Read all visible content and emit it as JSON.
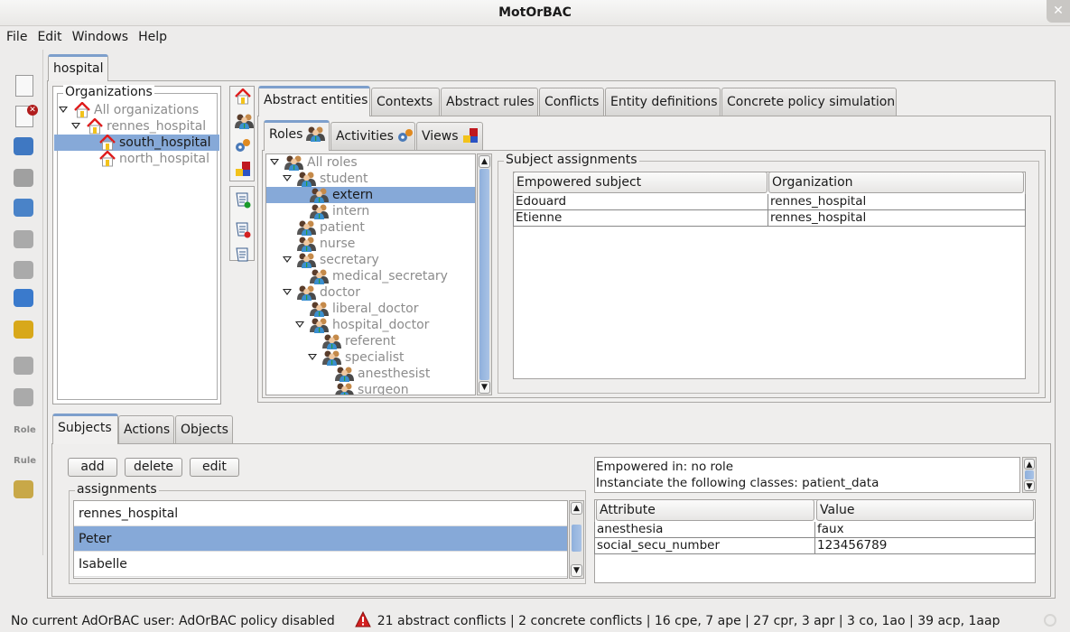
{
  "window": {
    "title": "MotOrBAC",
    "close_icon": "close-icon"
  },
  "menu": [
    "File",
    "Edit",
    "Windows",
    "Help"
  ],
  "toolbar": [
    "new-policy-icon",
    "close-policy-icon",
    "open-folder-icon",
    "save-icon",
    "save-as-icon",
    "undo-icon",
    "redo-icon",
    "refresh-icon",
    "security-lock-icon",
    "users-icon",
    "user-group-icon",
    "role-icon",
    "rule-icon",
    "search-icon"
  ],
  "toolbar_labels": {
    "role": "Role",
    "rule": "Rule"
  },
  "policy_tab": "hospital",
  "organizations": {
    "label": "Organizations",
    "items": [
      {
        "label": "All organizations",
        "depth": 0,
        "expanded": true,
        "selected": false
      },
      {
        "label": "rennes_hospital",
        "depth": 1,
        "expanded": true,
        "selected": false
      },
      {
        "label": "south_hospital",
        "depth": 2,
        "expanded": null,
        "selected": true
      },
      {
        "label": "north_hospital",
        "depth": 2,
        "expanded": null,
        "selected": false
      }
    ]
  },
  "side_icons": [
    "organization-icon",
    "roles-icon",
    "activities-icon",
    "views-icon",
    "rule-scroll-permission-icon",
    "rule-scroll-prohibition-icon",
    "rule-scroll-icon"
  ],
  "main_tabs": [
    "Abstract entities",
    "Contexts",
    "Abstract rules",
    "Conflicts",
    "Entity definitions",
    "Concrete policy simulation"
  ],
  "active_main_tab": "Abstract entities",
  "sub_tabs": [
    {
      "label": "Roles",
      "icon": "roles-icon"
    },
    {
      "label": "Activities",
      "icon": "activities-icon"
    },
    {
      "label": "Views",
      "icon": "views-icon"
    }
  ],
  "roles": [
    {
      "label": "All roles",
      "depth": 0,
      "expanded": true
    },
    {
      "label": "student",
      "depth": 1,
      "expanded": true
    },
    {
      "label": "extern",
      "depth": 2,
      "selected": true
    },
    {
      "label": "intern",
      "depth": 2
    },
    {
      "label": "patient",
      "depth": 1
    },
    {
      "label": "nurse",
      "depth": 1
    },
    {
      "label": "secretary",
      "depth": 1,
      "expanded": true
    },
    {
      "label": "medical_secretary",
      "depth": 2
    },
    {
      "label": "doctor",
      "depth": 1,
      "expanded": true
    },
    {
      "label": "liberal_doctor",
      "depth": 2
    },
    {
      "label": "hospital_doctor",
      "depth": 2,
      "expanded": true
    },
    {
      "label": "referent",
      "depth": 3
    },
    {
      "label": "specialist",
      "depth": 3,
      "expanded": true
    },
    {
      "label": "anesthesist",
      "depth": 4
    },
    {
      "label": "surgeon",
      "depth": 4
    }
  ],
  "subject_assignments": {
    "label": "Subject assignments",
    "columns": [
      "Empowered subject",
      "Organization"
    ],
    "rows": [
      [
        "Edouard",
        "rennes_hospital"
      ],
      [
        "Etienne",
        "rennes_hospital"
      ]
    ]
  },
  "bottom_tabs": [
    "Subjects",
    "Actions",
    "Objects"
  ],
  "buttons": {
    "add": "add",
    "delete": "delete",
    "edit": "edit"
  },
  "assignments": {
    "label": "assignments",
    "items": [
      {
        "label": "rennes_hospital"
      },
      {
        "label": "Peter",
        "selected": true
      },
      {
        "label": "Isabelle"
      }
    ]
  },
  "info": {
    "line1": "Empowered in:  no role",
    "line2": "Instanciate the following classes: patient_data"
  },
  "attributes": {
    "columns": [
      "Attribute",
      "Value"
    ],
    "rows": [
      [
        "anesthesia",
        "faux"
      ],
      [
        "social_secu_number",
        "123456789"
      ]
    ]
  },
  "status": {
    "user": "No current AdOrBAC user: AdOrBAC policy disabled",
    "conflicts": "21 abstract conflicts | 2 concrete conflicts | 16 cpe, 7 ape | 27 cpr, 3 apr | 3 co, 1ao | 39 acp, 1aap",
    "warning_icon": "warning-icon"
  },
  "colors": {
    "selection": "#86a9d8",
    "active_tab": "#7d9fcc",
    "warning": "#d42020"
  }
}
